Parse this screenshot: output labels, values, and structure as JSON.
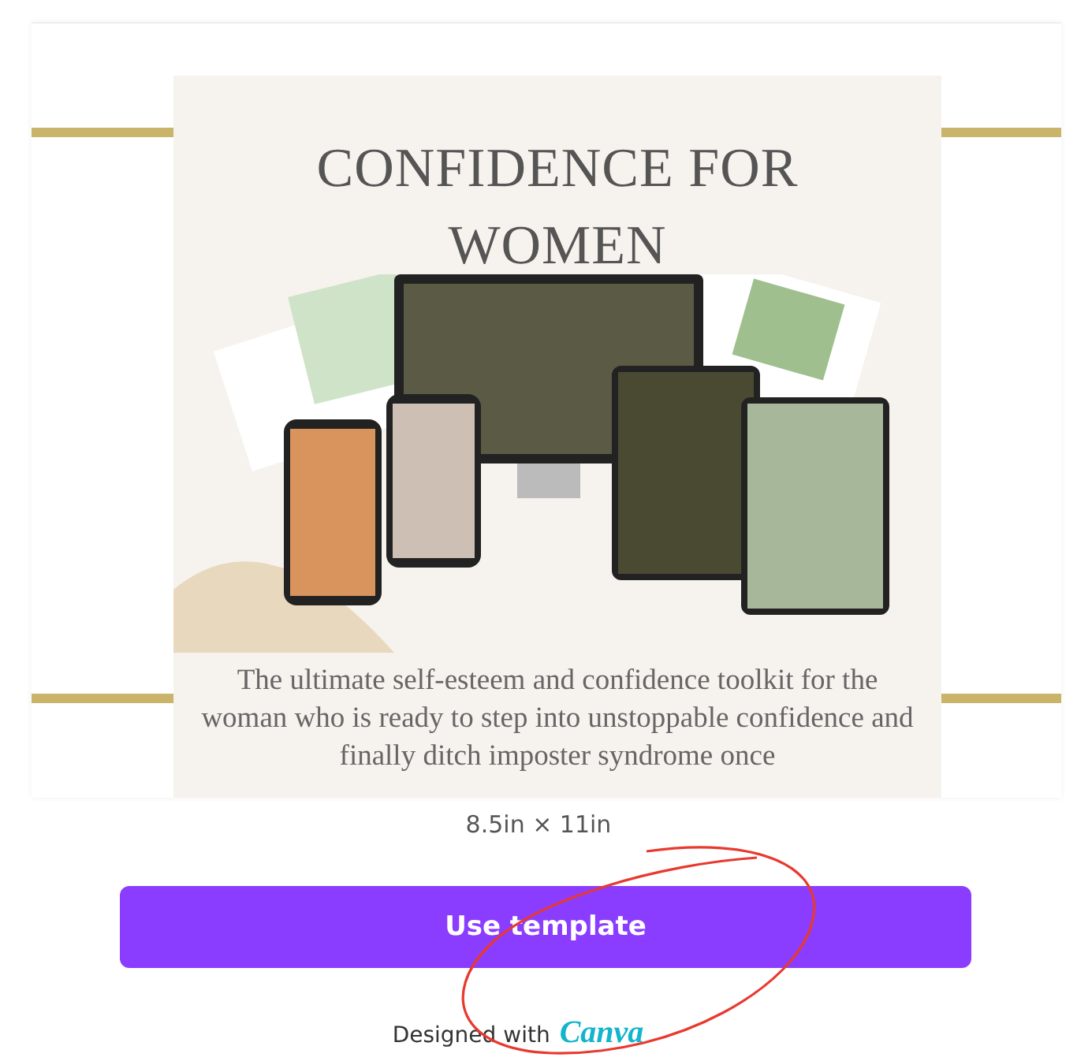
{
  "template": {
    "title": "CONFIDENCE FOR WOMEN",
    "subtitle": "The ultimate self-esteem and confidence toolkit for the woman who is ready to step into unstoppable confidence and finally ditch imposter syndrome once"
  },
  "size": "8.5in × 11in",
  "button": "Use template",
  "footer": {
    "text": "Designed with",
    "brand": "Canva"
  }
}
